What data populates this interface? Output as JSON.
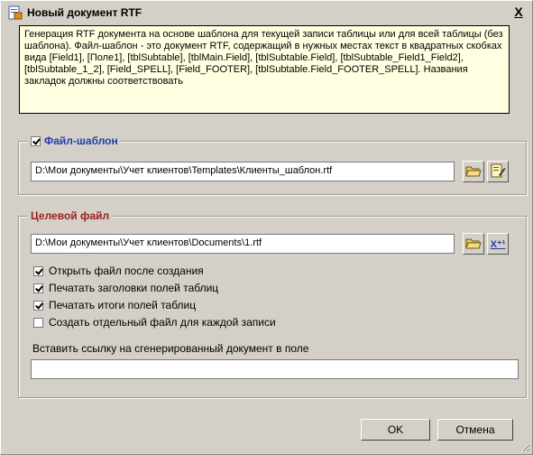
{
  "window": {
    "title": "Новый документ RTF",
    "close_label": "X"
  },
  "description": "Генерация RTF документа на основе шаблона для текущей записи таблицы или для всей таблицы (без шаблона). Файл-шаблон - это документ RTF, содержащий в нужных местах текст в квадратных скобках вида [Field1], [Поле1], [tblSubtable], [tblMain.Field], [tblSubtable.Field], [tblSubtable_Field1_Field2], [tblSubtable_1_2], [Field_SPELL], [Field_FOOTER], [tblSubtable.Field_FOOTER_SPELL]. Названия закладок должны соответствовать",
  "template_group": {
    "label": "Файл-шаблон",
    "checked": true,
    "path": "D:\\Мои документы\\Учет клиентов\\Templates\\Клиенты_шаблон.rtf",
    "open_icon": "folder-open-icon",
    "edit_icon": "edit-document-icon"
  },
  "target_group": {
    "label": "Целевой файл",
    "path": "D:\\Мои документы\\Учет клиентов\\Documents\\1.rtf",
    "open_icon": "folder-open-icon",
    "variable_icon": "x-variable-icon",
    "variable_label": "X⁺¹",
    "options": [
      {
        "label": "Открыть файл после создания",
        "checked": true
      },
      {
        "label": "Печатать заголовки полей таблиц",
        "checked": true
      },
      {
        "label": "Печатать итоги полей таблиц",
        "checked": true
      },
      {
        "label": "Создать отдельный файл для каждой записи",
        "checked": false
      }
    ],
    "link_field_label": "Вставить ссылку на сгенерированный документ в поле",
    "link_field_value": ""
  },
  "buttons": {
    "ok": "OK",
    "cancel": "Отмена"
  }
}
